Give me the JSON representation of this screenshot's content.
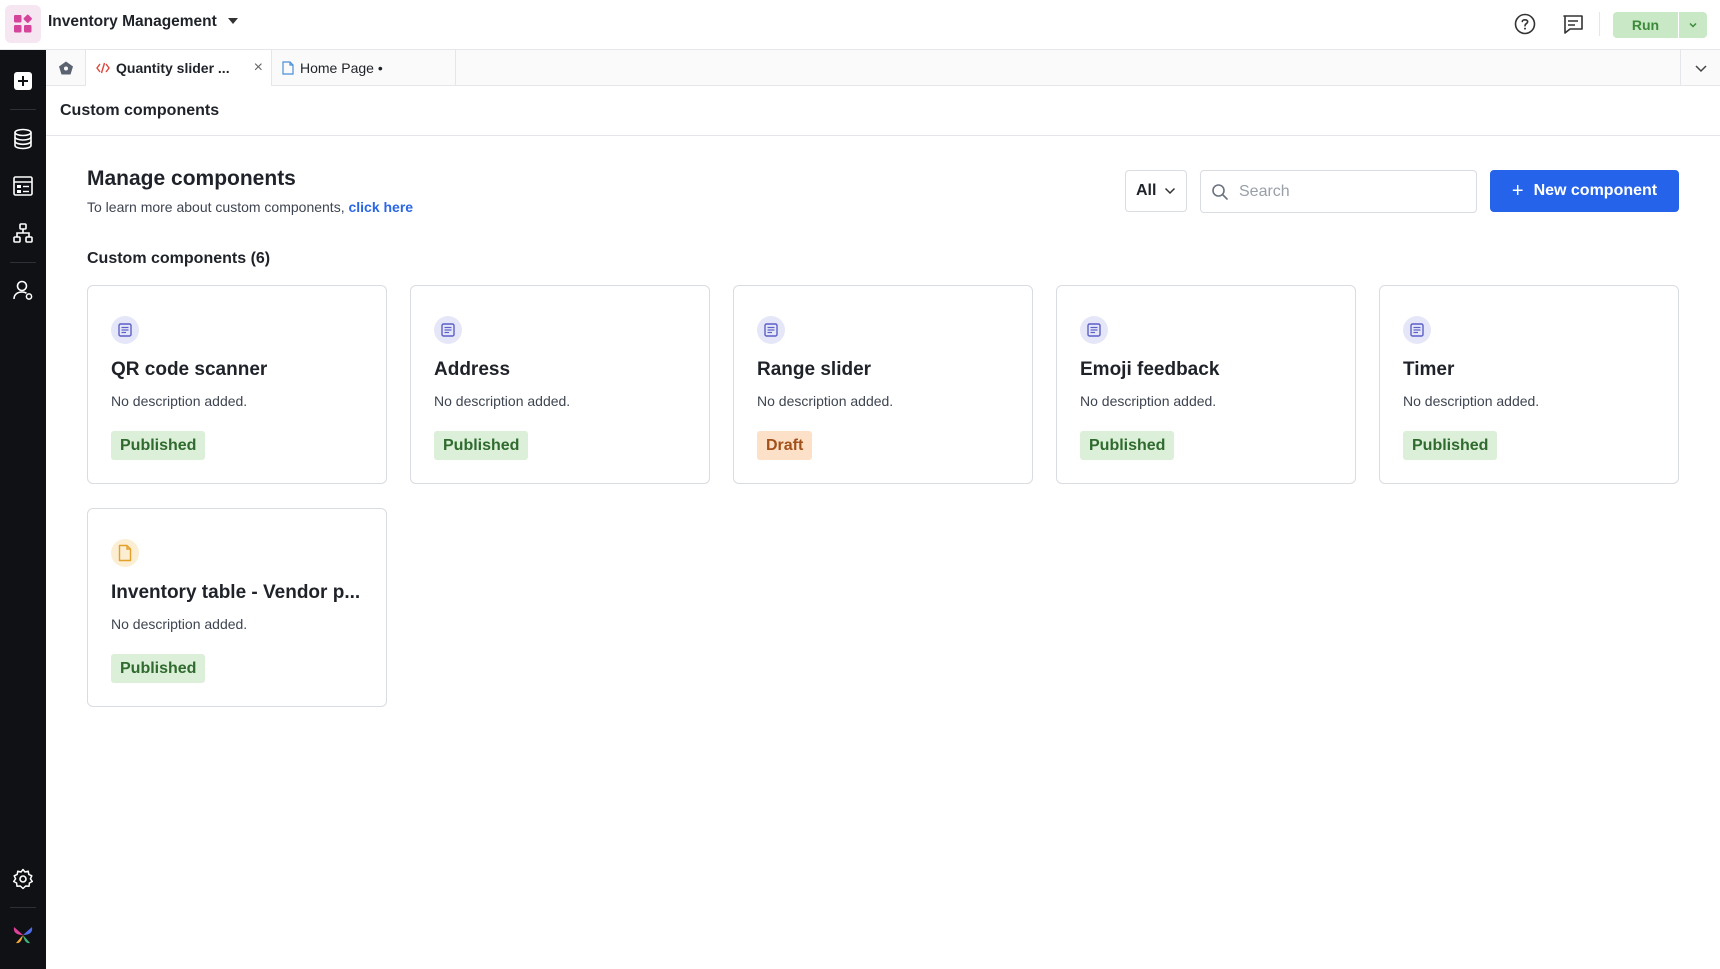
{
  "app": {
    "title": "Inventory Management"
  },
  "topbar": {
    "run_label": "Run"
  },
  "tabs": [
    {
      "label": "Quantity slider ...",
      "close": "×"
    },
    {
      "label": "Home Page •"
    }
  ],
  "section": {
    "title": "Custom components"
  },
  "manage": {
    "heading": "Manage components",
    "subtext": "To learn more about custom components, ",
    "link": "click here"
  },
  "filter": {
    "value": "All"
  },
  "search": {
    "placeholder": "Search"
  },
  "new_button": {
    "plus": "+",
    "label": "New component"
  },
  "components_count": "Custom components (6)",
  "components": [
    {
      "name": "QR code scanner",
      "description": "No description added.",
      "status": "Published",
      "icon": "document-icon"
    },
    {
      "name": "Address",
      "description": "No description added.",
      "status": "Published",
      "icon": "document-icon"
    },
    {
      "name": "Range slider",
      "description": "No description added.",
      "status": "Draft",
      "icon": "document-icon"
    },
    {
      "name": "Emoji feedback",
      "description": "No description added.",
      "status": "Published",
      "icon": "document-icon"
    },
    {
      "name": "Timer",
      "description": "No description added.",
      "status": "Published",
      "icon": "document-icon"
    },
    {
      "name": "Inventory table - Vendor p...",
      "description": "No description added.",
      "status": "Published",
      "icon": "file-icon"
    }
  ],
  "colors": {
    "accent": "#2563eb",
    "published_bg": "#dcefd9",
    "draft_bg": "#fde0c8",
    "run_bg": "#c9e8c6",
    "sidebar_bg": "#0f1114"
  }
}
